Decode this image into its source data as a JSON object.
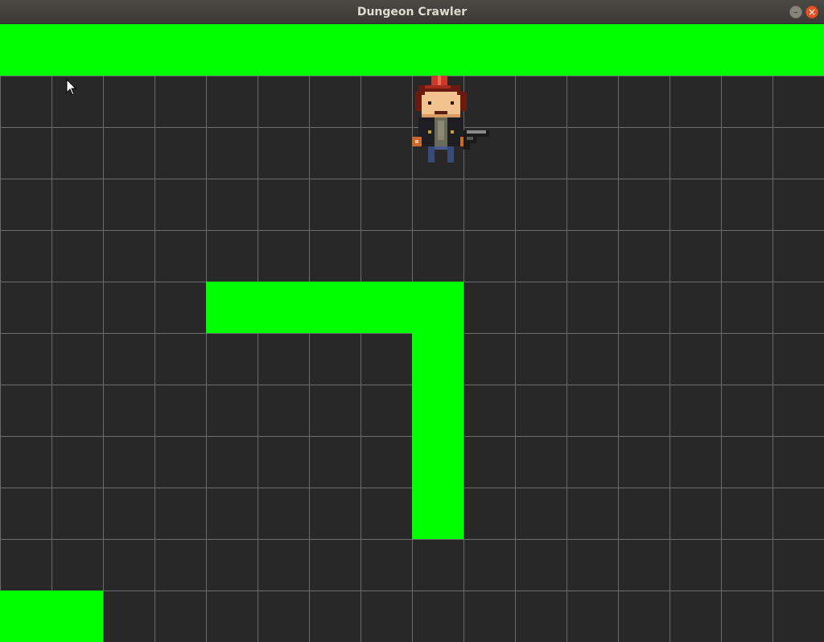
{
  "window": {
    "title": "Dungeon Crawler",
    "minimize_icon": "minimize-icon",
    "close_icon": "close-icon",
    "minimize_glyph": "–",
    "close_glyph": "×"
  },
  "game": {
    "background_color": "#282828",
    "grid_color": "#6a6a6a",
    "wall_color": "#00ff00",
    "grid": {
      "columns": 16,
      "rows": 12
    },
    "walls": [
      {
        "name": "top-wall",
        "col": 0,
        "row": 0,
        "cols": 16,
        "rows": 1
      },
      {
        "name": "horizontal-wall",
        "col": 4,
        "row": 5,
        "cols": 5,
        "rows": 1
      },
      {
        "name": "vertical-wall",
        "col": 8,
        "row": 6,
        "cols": 1,
        "rows": 4
      },
      {
        "name": "corner-wall",
        "col": 0,
        "row": 11,
        "cols": 2,
        "rows": 1
      }
    ],
    "player": {
      "sprite": "red-haired-adventurer-with-pistol",
      "col": 8,
      "row": 1
    }
  }
}
